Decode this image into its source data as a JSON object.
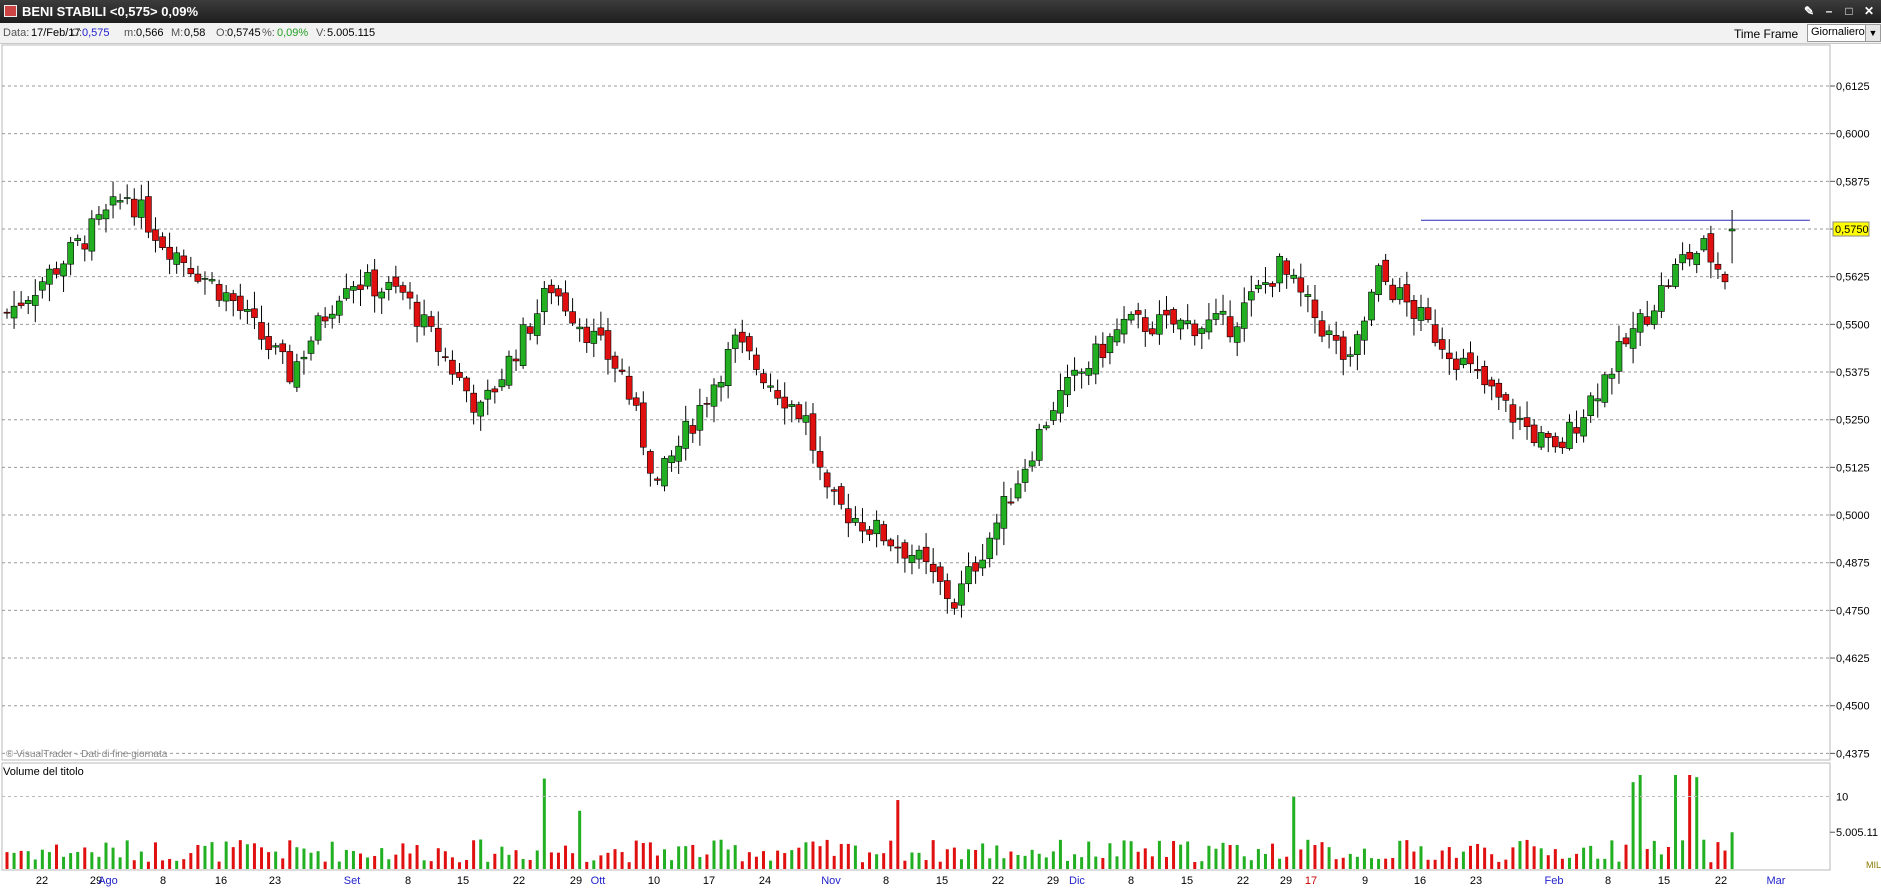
{
  "window": {
    "title": "BENI STABILI <0,575> 0,09%"
  },
  "info": {
    "data_label": "Data:",
    "data_value": "17/Feb/17",
    "close_label": "C:",
    "close_value": "0,575",
    "min_label": "m:",
    "min_value": "0,566",
    "max_label": "M:",
    "max_value": "0,58",
    "open_label": "O:",
    "open_value": "0,5745",
    "pct_label": "%:",
    "pct_value": "0,09%",
    "vol_label": "V:",
    "vol_value": "5.005.115",
    "timeframe_label": "Time Frame",
    "timeframe_value": "Giornaliero"
  },
  "colors": {
    "up": "#22b022",
    "down": "#e01010",
    "axis_text": "#000000",
    "month_text": "#2222cc",
    "year_text": "#cc0000",
    "price_tag": "#ffff00",
    "resistance_line": "#2a2ab8"
  },
  "chart_data": [
    {
      "type": "candlestick",
      "ylim": [
        0.4375,
        0.6125
      ],
      "y_ticks": [
        "0,6125",
        "0,6000",
        "0,5875",
        "0,5750",
        "0,5625",
        "0,5500",
        "0,5375",
        "0,5250",
        "0,5125",
        "0,5000",
        "0,4875",
        "0,4750",
        "0,4625",
        "0,4500",
        "0,4375"
      ],
      "last_price_label": "0,5750",
      "watermark": "© VisualTrader - Dati di fine giornata",
      "x_labels": [
        {
          "text": "22",
          "kind": "day"
        },
        {
          "text": "29",
          "kind": "day"
        },
        {
          "text": "Ago",
          "kind": "month"
        },
        {
          "text": "8",
          "kind": "day"
        },
        {
          "text": "16",
          "kind": "day"
        },
        {
          "text": "23",
          "kind": "day"
        },
        {
          "text": "Set",
          "kind": "month"
        },
        {
          "text": "8",
          "kind": "day"
        },
        {
          "text": "15",
          "kind": "day"
        },
        {
          "text": "22",
          "kind": "day"
        },
        {
          "text": "29",
          "kind": "day"
        },
        {
          "text": "Ott",
          "kind": "month"
        },
        {
          "text": "10",
          "kind": "day"
        },
        {
          "text": "17",
          "kind": "day"
        },
        {
          "text": "24",
          "kind": "day"
        },
        {
          "text": "Nov",
          "kind": "month"
        },
        {
          "text": "8",
          "kind": "day"
        },
        {
          "text": "15",
          "kind": "day"
        },
        {
          "text": "22",
          "kind": "day"
        },
        {
          "text": "29",
          "kind": "day"
        },
        {
          "text": "Dic",
          "kind": "month"
        },
        {
          "text": "8",
          "kind": "day"
        },
        {
          "text": "15",
          "kind": "day"
        },
        {
          "text": "22",
          "kind": "day"
        },
        {
          "text": "29",
          "kind": "day"
        },
        {
          "text": "17",
          "kind": "year"
        },
        {
          "text": "9",
          "kind": "day"
        },
        {
          "text": "16",
          "kind": "day"
        },
        {
          "text": "23",
          "kind": "day"
        },
        {
          "text": "Feb",
          "kind": "month"
        },
        {
          "text": "8",
          "kind": "day"
        },
        {
          "text": "15",
          "kind": "day"
        },
        {
          "text": "22",
          "kind": "day"
        },
        {
          "text": "Mar",
          "kind": "month"
        }
      ],
      "resistance_level": 0.5773,
      "anchors": [
        [
          0,
          0.553
        ],
        [
          7,
          0.565
        ],
        [
          17,
          0.584
        ],
        [
          22,
          0.572
        ],
        [
          32,
          0.556
        ],
        [
          40,
          0.537
        ],
        [
          48,
          0.562
        ],
        [
          56,
          0.558
        ],
        [
          67,
          0.527
        ],
        [
          77,
          0.56
        ],
        [
          87,
          0.537
        ],
        [
          92,
          0.508
        ],
        [
          103,
          0.545
        ],
        [
          113,
          0.525
        ],
        [
          116,
          0.504
        ],
        [
          128,
          0.49
        ],
        [
          134,
          0.477
        ],
        [
          140,
          0.498
        ],
        [
          148,
          0.529
        ],
        [
          158,
          0.55
        ],
        [
          173,
          0.55
        ],
        [
          180,
          0.565
        ],
        [
          190,
          0.539
        ],
        [
          194,
          0.563
        ],
        [
          212,
          0.528
        ],
        [
          219,
          0.516
        ],
        [
          229,
          0.545
        ],
        [
          237,
          0.567
        ],
        [
          240,
          0.57
        ],
        [
          244,
          0.56
        ]
      ],
      "volume_panel": {
        "title": "Volume del titolo",
        "tick": "10",
        "last_volume": "5.005.11",
        "unit": "MIL",
        "vmax": 13
      }
    }
  ]
}
